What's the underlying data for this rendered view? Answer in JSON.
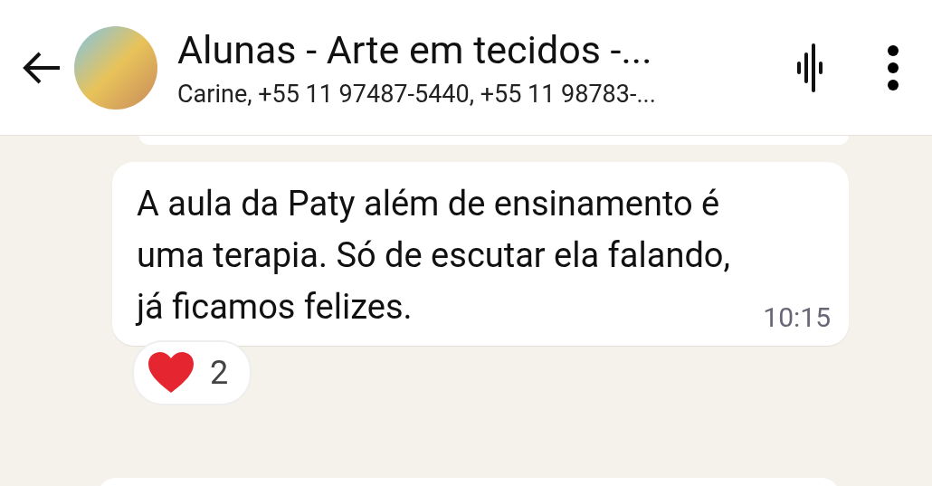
{
  "header": {
    "title": "Alunas - Arte em tecidos -...",
    "subtitle": "Carine, +55 11 97487-5440, +55 11 98783-..."
  },
  "message": {
    "text": "A aula da Paty além de ensinamento é uma terapia. Só de escutar ela falando, já ficamos felizes.",
    "time": "10:15"
  },
  "reaction": {
    "count": "2"
  }
}
